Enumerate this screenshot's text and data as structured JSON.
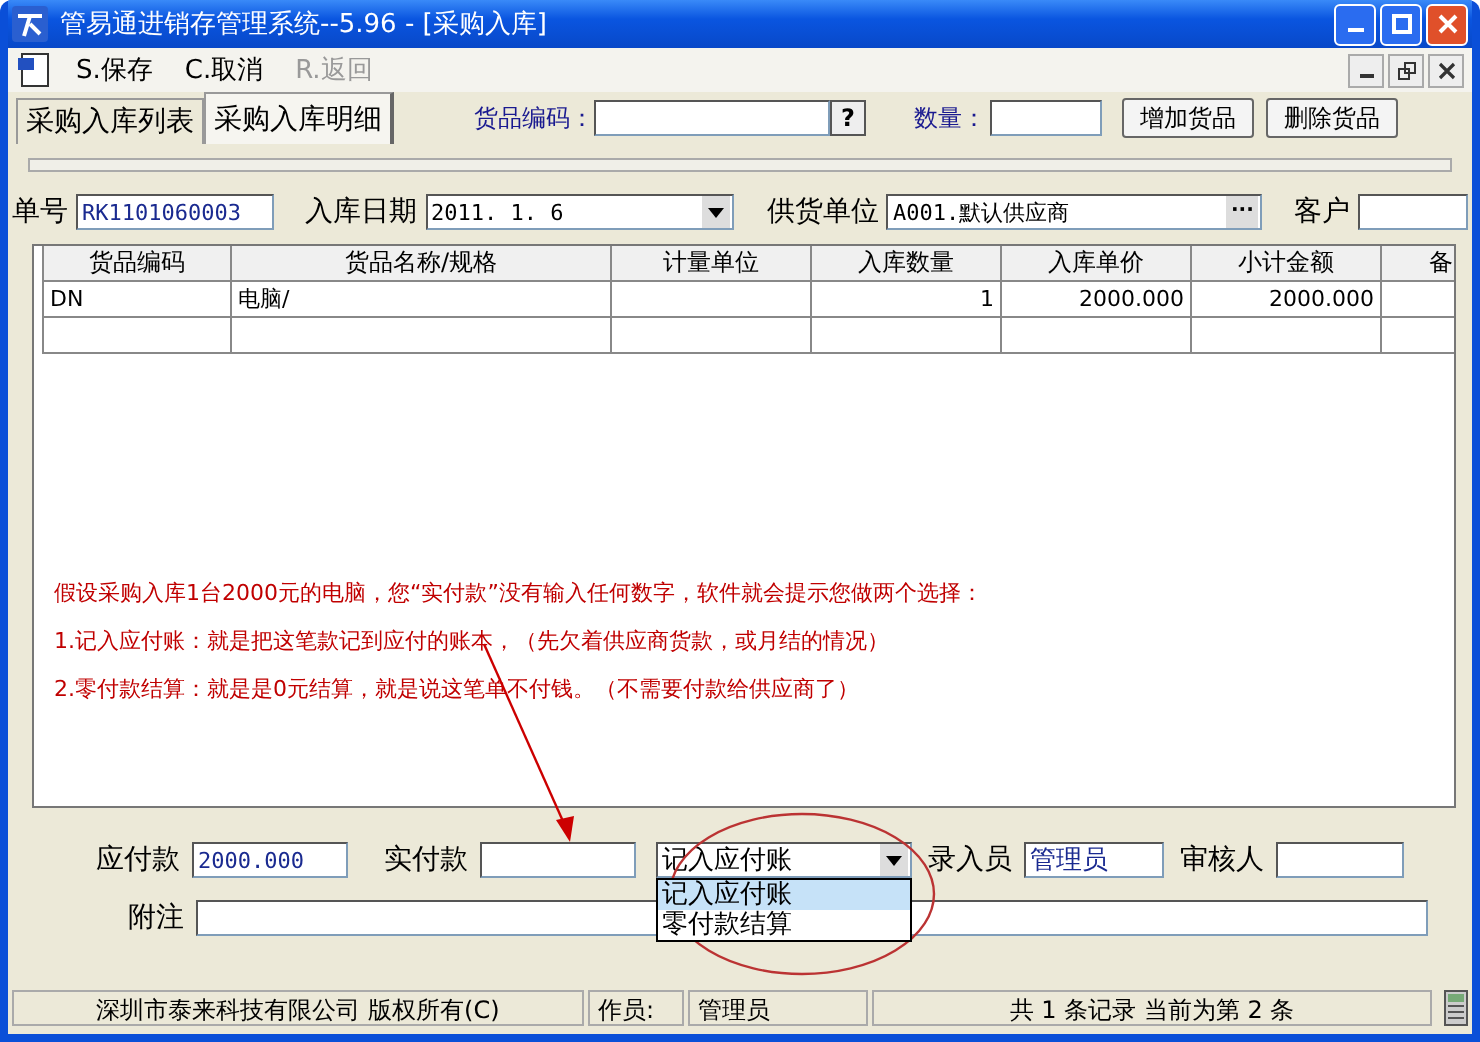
{
  "window": {
    "title": "管易通进销存管理系统--5.96 - [采购入库]"
  },
  "toolbar": [
    {
      "label": "S.保存",
      "disabled": false
    },
    {
      "label": "C.取消",
      "disabled": false
    },
    {
      "label": "R.返回",
      "disabled": true
    }
  ],
  "tabs": [
    {
      "label": "采购入库列表",
      "selected": false
    },
    {
      "label": "采购入库明细",
      "selected": true
    }
  ],
  "item_entry": {
    "code_label": "货品编码：",
    "help_button": "?",
    "qty_label": "数量：",
    "buttons": [
      "增加货品",
      "删除货品"
    ]
  },
  "header_fields": [
    {
      "label": "单号",
      "value": "RK1101060003",
      "kind": "text"
    },
    {
      "label": "入库日期",
      "value": "2011. 1. 6",
      "kind": "dropdown"
    },
    {
      "label": "供货单位",
      "value": "A001.默认供应商",
      "kind": "lookup",
      "button": "···"
    },
    {
      "label": "客户",
      "kind": "text"
    }
  ],
  "table": {
    "columns": [
      "货品编码",
      "货品名称/规格",
      "计量单位",
      "入库数量",
      "入库单价",
      "小计金额",
      "备"
    ],
    "rows": [
      [
        "DN",
        "电脑/",
        "",
        "1",
        "2000.000",
        "2000.000",
        ""
      ],
      [
        "",
        "",
        "",
        "",
        "",
        "",
        ""
      ]
    ]
  },
  "annotation": [
    "假设采购入库1台2000元的电脑，您“实付款”没有输入任何数字，软件就会提示您做两个选择：",
    "1.记入应付账：就是把这笔款记到应付的账本，（先欠着供应商货款，或月结的情况）",
    "2.零付款结算：就是是0元结算，就是说这笔单不付钱。（不需要付款给供应商了）"
  ],
  "footer": {
    "payable": {
      "label": "应付款",
      "value": "2000.000"
    },
    "paid": {
      "label": "实付款"
    },
    "payment_mode": {
      "value": "记入应付账",
      "expanded": true,
      "options": [
        {
          "label": "记入应付账",
          "selected": true
        },
        {
          "label": "零付款结算",
          "selected": false
        }
      ]
    },
    "entered_by": {
      "label": "录入员",
      "value": "管理员"
    },
    "reviewer": {
      "label": "审核人"
    },
    "note": {
      "label": "附注"
    }
  },
  "status_bar": [
    "深圳市泰来科技有限公司 版权所有(C)",
    "作员:",
    "管理员",
    "共 1 条记录 当前为第 2 条"
  ]
}
